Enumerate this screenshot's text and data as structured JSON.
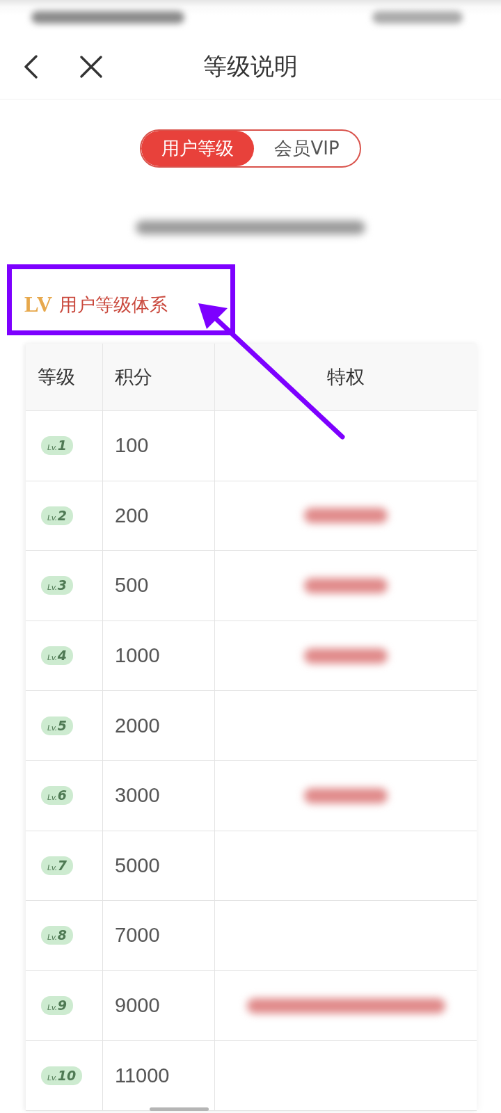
{
  "status_bar": {
    "redacted": true
  },
  "header": {
    "title": "等级说明"
  },
  "tabs": [
    {
      "label": "用户等级",
      "selected": true
    },
    {
      "label": "会员VIP",
      "selected": false
    }
  ],
  "notice": {
    "redacted": true
  },
  "section": {
    "badge": "LV",
    "title": "用户等级体系"
  },
  "annotation": {
    "highlight_box": true,
    "arrow": true
  },
  "table": {
    "columns": [
      "等级",
      "积分",
      "特权"
    ],
    "rows": [
      {
        "level_prefix": "Lv.",
        "level_number": "1",
        "points": "100",
        "privilege_redacted": false
      },
      {
        "level_prefix": "Lv.",
        "level_number": "2",
        "points": "200",
        "privilege_redacted": true,
        "privilege_wide": false
      },
      {
        "level_prefix": "Lv.",
        "level_number": "3",
        "points": "500",
        "privilege_redacted": true,
        "privilege_wide": false
      },
      {
        "level_prefix": "Lv.",
        "level_number": "4",
        "points": "1000",
        "privilege_redacted": true,
        "privilege_wide": false
      },
      {
        "level_prefix": "Lv.",
        "level_number": "5",
        "points": "2000",
        "privilege_redacted": false
      },
      {
        "level_prefix": "Lv.",
        "level_number": "6",
        "points": "3000",
        "privilege_redacted": true,
        "privilege_wide": false
      },
      {
        "level_prefix": "Lv.",
        "level_number": "7",
        "points": "5000",
        "privilege_redacted": false
      },
      {
        "level_prefix": "Lv.",
        "level_number": "8",
        "points": "7000",
        "privilege_redacted": false
      },
      {
        "level_prefix": "Lv.",
        "level_number": "9",
        "points": "9000",
        "privilege_redacted": true,
        "privilege_wide": true
      },
      {
        "level_prefix": "Lv.",
        "level_number": "10",
        "points": "11000",
        "privilege_redacted": false
      }
    ]
  }
}
